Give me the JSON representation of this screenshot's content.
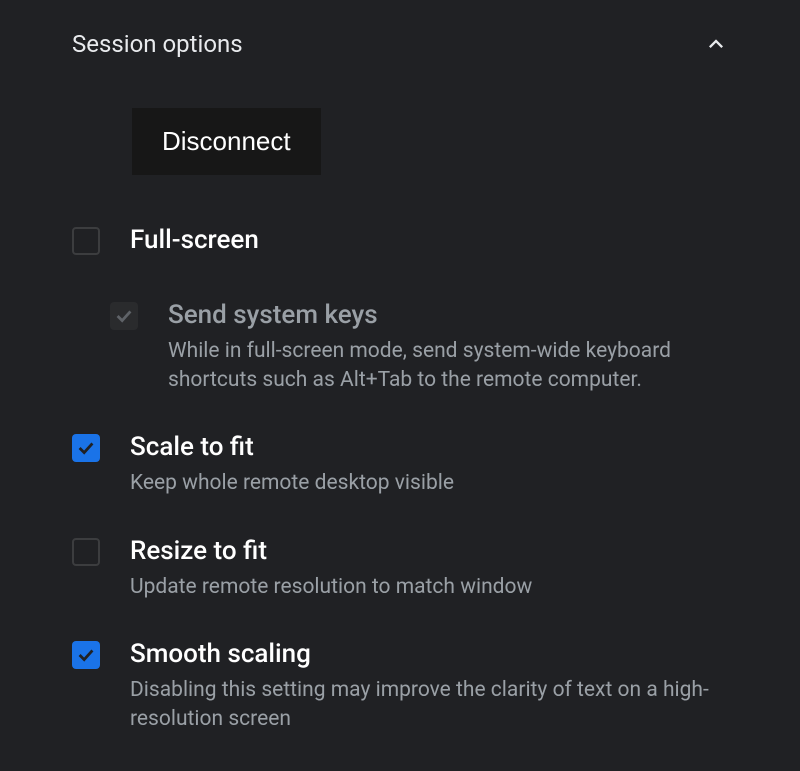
{
  "header": {
    "title": "Session options"
  },
  "actions": {
    "disconnect_label": "Disconnect"
  },
  "options": {
    "fullscreen": {
      "title": "Full-screen",
      "checked": false
    },
    "send_system_keys": {
      "title": "Send system keys",
      "desc": "While in full-screen mode, send system-wide keyboard shortcuts such as Alt+Tab to the remote computer.",
      "checked": true,
      "disabled": true
    },
    "scale_to_fit": {
      "title": "Scale to fit",
      "desc": "Keep whole remote desktop visible",
      "checked": true
    },
    "resize_to_fit": {
      "title": "Resize to fit",
      "desc": "Update remote resolution to match window",
      "checked": false
    },
    "smooth_scaling": {
      "title": "Smooth scaling",
      "desc": "Disabling this setting may improve the clarity of text on a high-resolution screen",
      "checked": true
    }
  }
}
